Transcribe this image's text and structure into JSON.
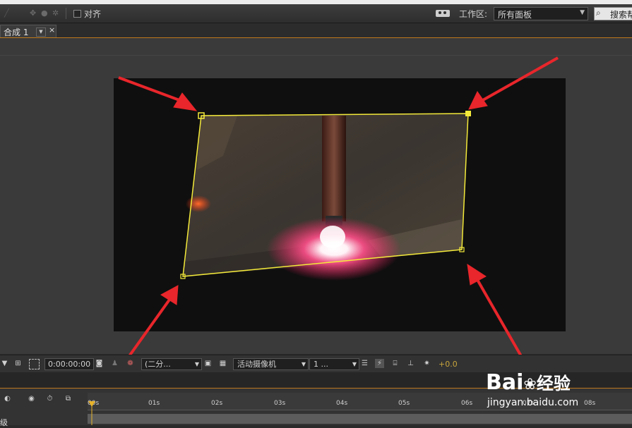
{
  "top_strip": {
    "label": ""
  },
  "toolbar": {
    "align_label": "对齐",
    "workspace_label": "工作区:",
    "workspace_value": "所有面板",
    "search_label": "搜索帮助"
  },
  "tabs": [
    {
      "label": "合成 1"
    }
  ],
  "viewer_toolbar": {
    "timecode": "0:00:00:00",
    "resolution": "(二分...",
    "camera": "活动摄像机",
    "views": "1 ...",
    "exposure": "+0.0"
  },
  "timeline": {
    "ruler_ticks": [
      "00s",
      "01s",
      "02s",
      "03s",
      "04s",
      "05s",
      "06s",
      "07s",
      "08s"
    ],
    "level_label": "级"
  },
  "watermark": {
    "logo": "Bai",
    "logo_suffix": "经验",
    "url": "jingyan.baidu.com"
  },
  "colors": {
    "accent": "#c07a1a",
    "corner_pin": "#f4ea3a",
    "arrow": "#e8262b"
  },
  "icons": [
    "camera-icon",
    "person-icon",
    "color-channels-icon",
    "grid-icon",
    "fast-preview-icon",
    "flowchart-icon",
    "exposure-icon"
  ]
}
